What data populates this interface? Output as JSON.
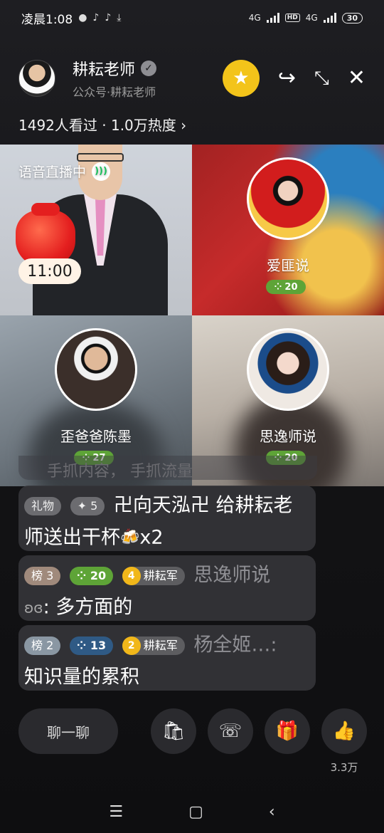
{
  "status_bar": {
    "time": "凌晨1:08",
    "network1": "4G",
    "hd": "HD",
    "network2": "4G",
    "battery": "30"
  },
  "header": {
    "host_name": "耕耘老师",
    "host_sub": "公众号·耕耘老师",
    "actions": [
      "favorite-star-icon",
      "share-icon",
      "minimize-icon",
      "close-icon"
    ]
  },
  "stats": {
    "viewers_text": "1492人看过 · 1.0万热度"
  },
  "room": {
    "live_label": "语音直播中",
    "timer": "11:00",
    "guests": [
      {
        "name": "爱匪说",
        "level": "20"
      },
      {
        "name": "歪爸爸陈墨",
        "level": "27"
      },
      {
        "name": "思逸师说",
        "level": "20"
      }
    ]
  },
  "chat": {
    "ghost_text": "手抓内容，    手抓流量",
    "messages": [
      {
        "tag1": "礼物",
        "tag2": "✦ 5",
        "user": "卍向天泓卍",
        "text": "给耕耘老师送出干杯",
        "suffix": "x2"
      },
      {
        "rank": "榜 3",
        "level": "20",
        "fan_level": "4",
        "fan_club": "耕耘军",
        "user": "思逸师说",
        "text": "多方面的"
      },
      {
        "rank": "榜 2",
        "level": "13",
        "fan_level": "2",
        "fan_club": "耕耘军",
        "user": "杨全姬…:",
        "text": "知识量的累积"
      }
    ]
  },
  "bottom": {
    "chat_label": "聊一聊",
    "like_count": "3.3万"
  },
  "colors": {
    "accent_yellow": "#f3c41a",
    "level_green": "#5ea437",
    "level_blue": "#2f5a85"
  }
}
